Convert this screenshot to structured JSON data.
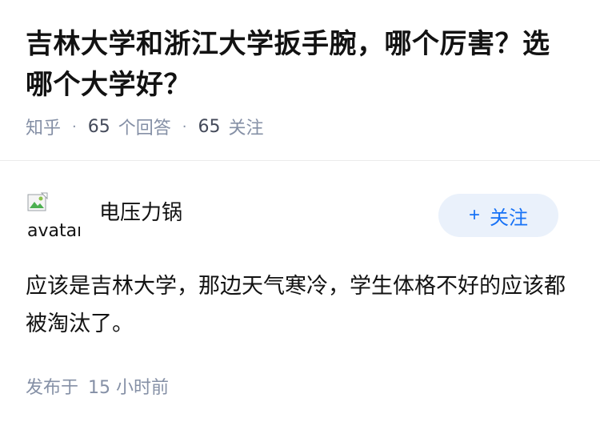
{
  "question": {
    "title": "吉林大学和浙江大学扳手腕，哪个厉害？选哪个大学好？",
    "source": "知乎",
    "answer_count": "65",
    "answer_label": "个回答",
    "follow_count": "65",
    "follow_label": "关注"
  },
  "answer": {
    "avatar_alt": "avatar",
    "author_name": "电压力锅",
    "follow_button": "关注",
    "content": "应该是吉林大学，那边天气寒冷，学生体格不好的应该都被淘汰了。",
    "published_label": "发布于",
    "published_time": "15 小时前"
  },
  "colors": {
    "accent": "#1772f6",
    "button_bg": "#eaf1fb",
    "meta_text": "#8590a6"
  }
}
